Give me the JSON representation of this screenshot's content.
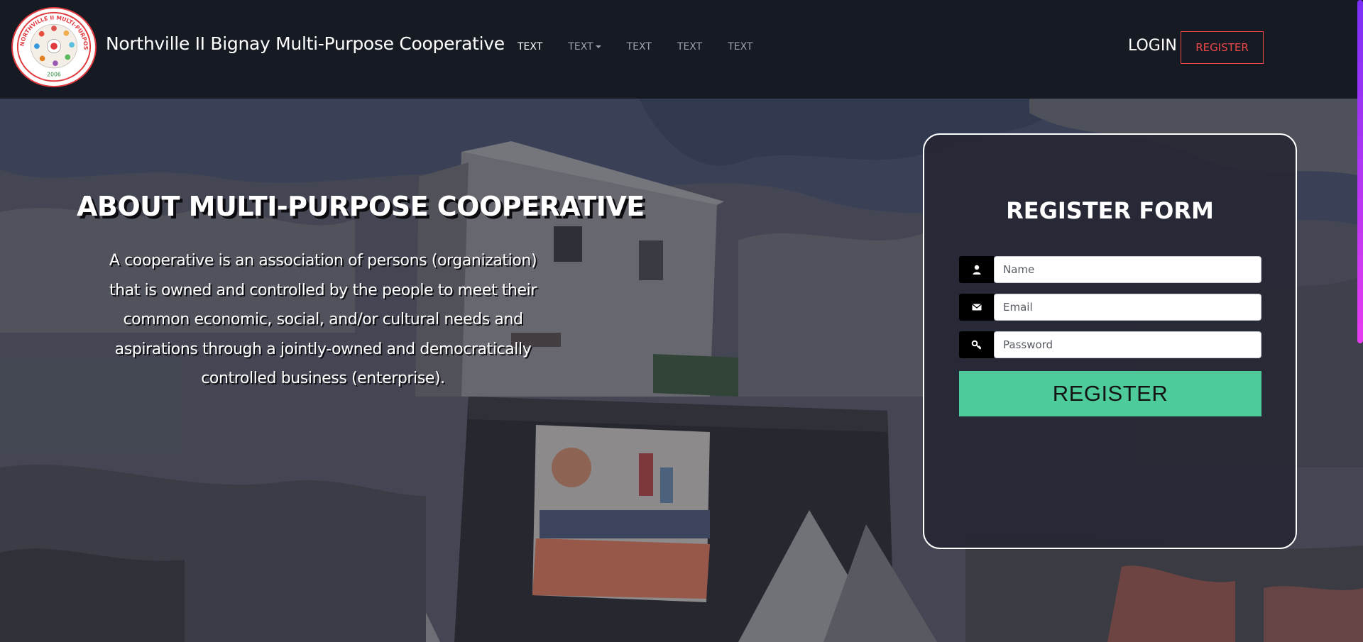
{
  "navbar": {
    "brand_name": "Northville II Bignay Multi-Purpose Cooperative",
    "logo_text_top": "NORTHVILLE II MULTI-PURPOSE COOPERATIVE",
    "logo_year": "2006",
    "links": [
      {
        "label": "TEXT",
        "active": true,
        "dropdown": false
      },
      {
        "label": "TEXT",
        "active": false,
        "dropdown": true
      },
      {
        "label": "TEXT",
        "active": false,
        "dropdown": false
      },
      {
        "label": "TEXT",
        "active": false,
        "dropdown": false
      },
      {
        "label": "TEXT",
        "active": false,
        "dropdown": false
      }
    ],
    "login_label": "LOGIN",
    "register_label": "REGISTER"
  },
  "about": {
    "title": "ABOUT MULTI-PURPOSE COOPERATIVE",
    "text": "A cooperative is an association of persons (organization) that is owned and controlled by the people to meet their common economic, social, and/or cultural needs and aspirations through a jointly-owned and democratically controlled business (enterprise)."
  },
  "register_form": {
    "title": "REGISTER FORM",
    "name_placeholder": "Name",
    "email_placeholder": "Email",
    "password_placeholder": "Password",
    "submit_label": "REGISTER",
    "icons": [
      "user-icon",
      "envelope-icon",
      "key-icon"
    ]
  },
  "colors": {
    "navbar_bg": "#161a23",
    "register_accent": "#e94848",
    "submit_bg": "#4ecb9a",
    "card_border": "#ffffff"
  }
}
